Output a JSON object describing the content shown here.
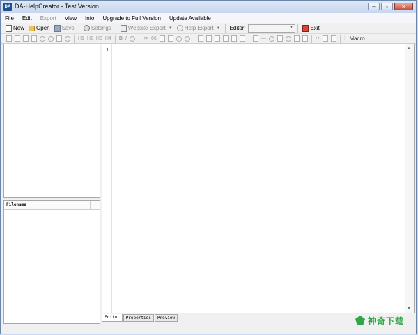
{
  "window": {
    "app_icon": "DA",
    "title": "DA-HelpCreator - Test Version",
    "minimize_glyph": "–",
    "restore_glyph": "▫",
    "close_glyph": "✕"
  },
  "menu": {
    "file": "File",
    "edit": "Edit",
    "export": "Export",
    "view": "View",
    "info": "Info",
    "upgrade": "Upgrade to Full Version",
    "update": "Update Available"
  },
  "toolbar": {
    "new": "New",
    "open": "Open",
    "save": "Save",
    "settings": "Settings",
    "website_export": "Website Export",
    "help_export": "Help Export",
    "editor_label": "Editor",
    "editor_value": "",
    "exit": "Exit"
  },
  "format_toolbar": {
    "h1": "H1",
    "h2": "H2",
    "h3": "H3",
    "h4": "H4",
    "bold": "B",
    "italic": "I",
    "code": "<>",
    "quote": "66",
    "macro": "Macro"
  },
  "file_list": {
    "column_filename": "Filename"
  },
  "editor": {
    "line_numbers": [
      "1"
    ]
  },
  "tabs": {
    "editor": "Editor",
    "properties": "Properties",
    "preview": "Preview"
  },
  "watermark": {
    "text": "神奇下载"
  },
  "colors": {
    "titlebar": "#c6d6ec",
    "watermark": "#2fa64a",
    "exit_icon": "#d9443a"
  }
}
